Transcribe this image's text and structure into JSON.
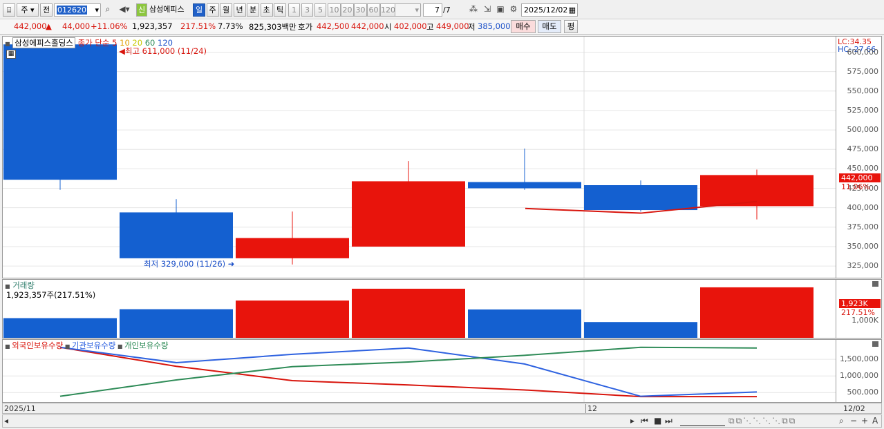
{
  "toolbar": {
    "mode": "주",
    "prev": "전",
    "code": "012620",
    "type_badge": "신",
    "name": "삼성에피스",
    "periods": [
      "일",
      "주",
      "월",
      "년",
      "분",
      "초",
      "틱"
    ],
    "intervals": [
      "1",
      "3",
      "5",
      "10",
      "20",
      "30",
      "60",
      "120"
    ],
    "page_value": "7",
    "page_total": "/7",
    "date": "2025/12/02"
  },
  "quote": {
    "price": "442,000",
    "arrow": "▲",
    "change": "44,000",
    "change_pct": "+11.06%",
    "volume": "1,923,357",
    "volume_ratio": "217.51%",
    "turnover": "7.73%",
    "amount": "825,303백만",
    "bid_label": "호가",
    "ask_price": "442,500",
    "bid_price": "442,000",
    "open_label": "시",
    "open": "402,000",
    "high_label": "고",
    "high": "449,000",
    "low_label": "저",
    "low": "385,000",
    "buy_label": "매수",
    "sell_label": "매도",
    "avg_label": "평"
  },
  "price_panel": {
    "legend_name": "삼성에피스홀딩스",
    "legend_kind": "종가 단순",
    "ma": [
      "5",
      "10",
      "20",
      "60",
      "120"
    ],
    "ma_colors": [
      "#d8140c",
      "#e0a000",
      "#c8c800",
      "#2e8b57",
      "#1a4fc8"
    ],
    "high_note": "최고 611,000 (11/24)",
    "low_note": "최저 329,000 (11/26)",
    "lc": "LC:34.35",
    "hc": "HC:-27.66",
    "price_tag": "442,000",
    "pct_tag": "11.06%"
  },
  "volume_panel": {
    "legend": "거래량",
    "value": "1,923,357주(217.51%)",
    "tag_value": "1,923K",
    "tag_pct": "217.51%",
    "axis_label": "1,000K"
  },
  "holdings_panel": {
    "legend": [
      "외국인보유수량",
      "기관보유수량",
      "개인보유수량"
    ],
    "colors": [
      "#d8140c",
      "#2e62e0",
      "#2e8b57"
    ]
  },
  "status": {
    "left_date": "2025/11",
    "mid_label": "12",
    "right_date": "12/02"
  },
  "chart_data": [
    {
      "type": "candlestick",
      "title": "삼성에피스홀딩스",
      "y_ticks": [
        325000,
        350000,
        375000,
        400000,
        425000,
        450000,
        475000,
        500000,
        525000,
        550000,
        575000,
        600000
      ],
      "ylim": [
        310000,
        620000
      ],
      "candles": [
        {
          "open": 610000,
          "high": 611000,
          "low": 423000,
          "close": 436000
        },
        {
          "open": 394000,
          "high": 411000,
          "low": 335000,
          "close": 335000
        },
        {
          "open": 335000,
          "high": 395000,
          "low": 327000,
          "close": 361000
        },
        {
          "open": 350000,
          "high": 460000,
          "low": 350000,
          "close": 434000
        },
        {
          "open": 433000,
          "high": 476000,
          "low": 423000,
          "close": 425000
        },
        {
          "open": 429000,
          "high": 435000,
          "low": 395000,
          "close": 397000
        },
        {
          "open": 402000,
          "high": 449000,
          "low": 385000,
          "close": 442000
        }
      ],
      "ma5_line": [
        null,
        null,
        null,
        null,
        399000,
        393000,
        408000
      ]
    },
    {
      "type": "bar",
      "title": "거래량",
      "values": [
        750,
        1090,
        1420,
        1870,
        1080,
        600,
        1923
      ],
      "directions": [
        "down",
        "down",
        "up",
        "up",
        "down",
        "down",
        "up"
      ],
      "ylim": [
        0,
        2000
      ]
    },
    {
      "type": "line",
      "series": [
        {
          "name": "외국인보유수량",
          "values": [
            1860000,
            1290000,
            860000,
            730000,
            580000,
            380000,
            380000
          ]
        },
        {
          "name": "기관보유수량",
          "values": [
            1860000,
            1400000,
            1650000,
            1840000,
            1360000,
            390000,
            520000
          ]
        },
        {
          "name": "개인보유수량",
          "values": [
            390000,
            880000,
            1280000,
            1420000,
            1620000,
            1860000,
            1840000
          ]
        }
      ],
      "y_ticks": [
        500000,
        1000000,
        1500000
      ],
      "ylim": [
        300000,
        2000000
      ]
    }
  ]
}
